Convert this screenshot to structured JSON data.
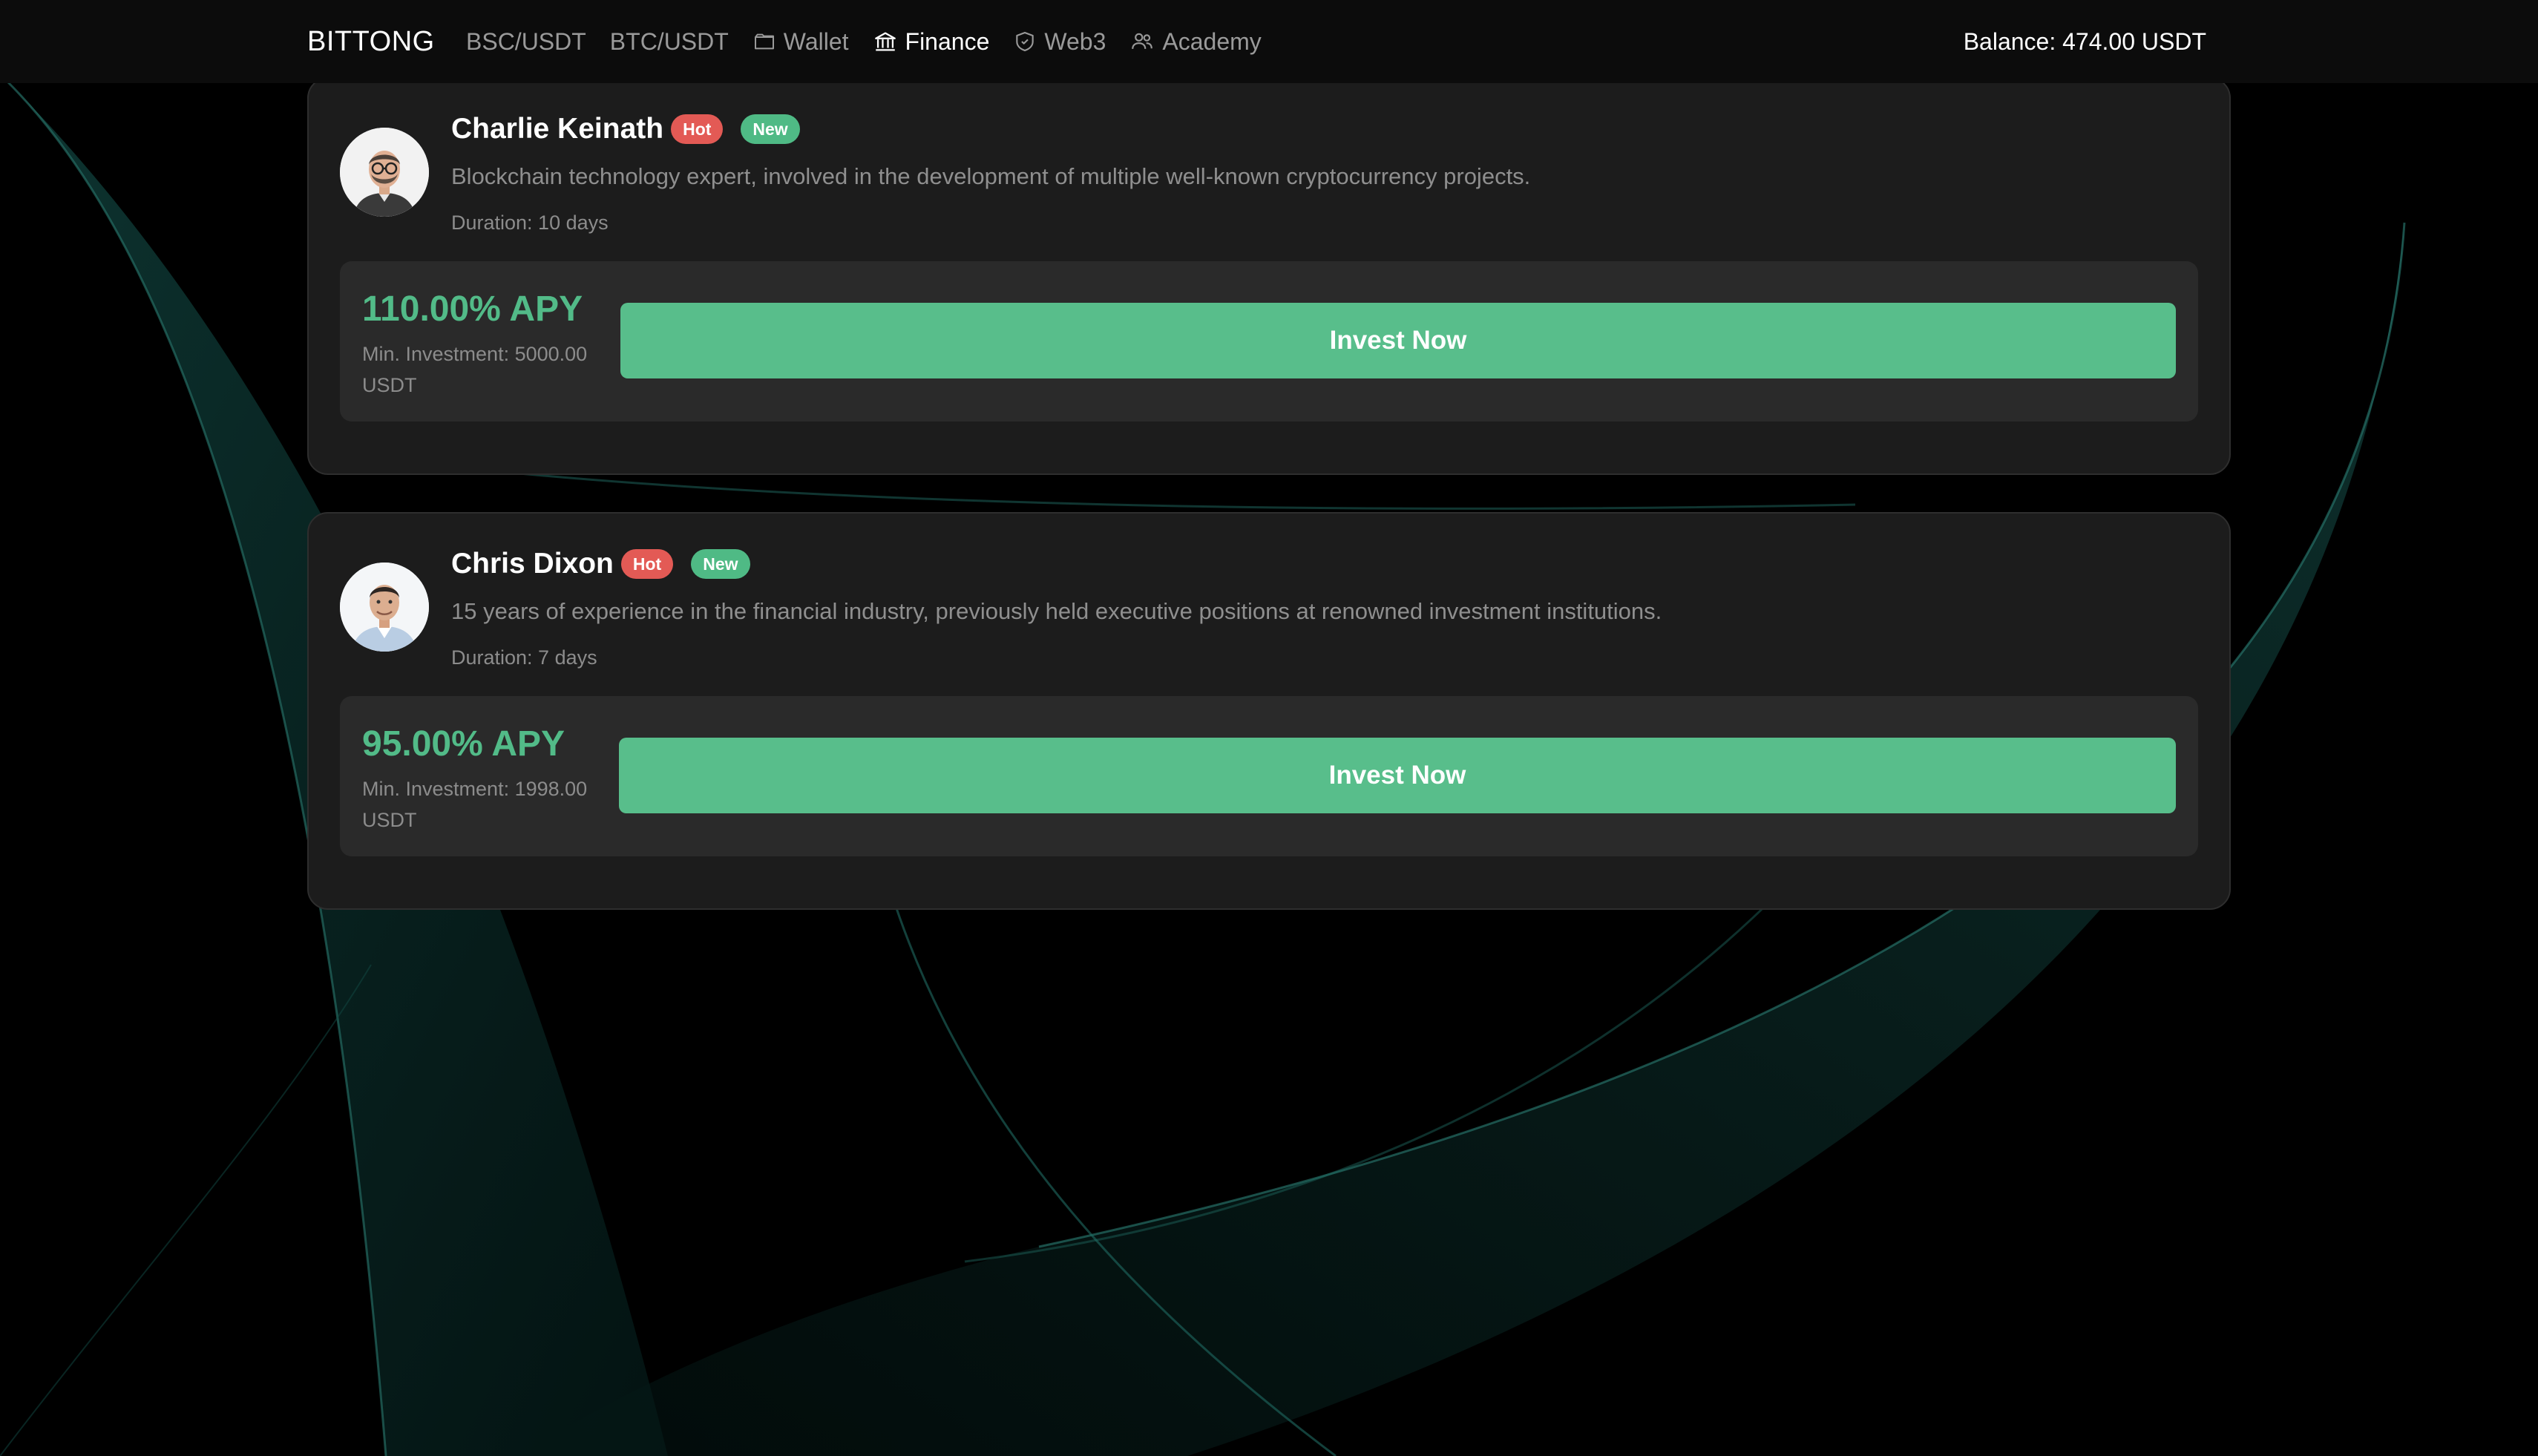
{
  "nav": {
    "brand": "BITTONG",
    "links": [
      {
        "label": "BSC/USDT",
        "icon": "",
        "active": false
      },
      {
        "label": "BTC/USDT",
        "icon": "",
        "active": false
      },
      {
        "label": "Wallet",
        "icon": "wallet-icon",
        "active": false
      },
      {
        "label": "Finance",
        "icon": "bank-icon",
        "active": true
      },
      {
        "label": "Web3",
        "icon": "shield-icon",
        "active": false
      },
      {
        "label": "Academy",
        "icon": "users-icon",
        "active": false
      }
    ],
    "balance": "Balance: 474.00 USDT"
  },
  "traders": [
    {
      "name": "Charlie Keinath",
      "hot_label": "Hot",
      "new_label": "New",
      "description": "Blockchain technology expert, involved in the development of multiple well-known cryptocurrency projects.",
      "duration": "Duration: 10 days",
      "apy": "110.00% APY",
      "min_investment": "Min. Investment: 5000.00 USDT",
      "button_label": "Invest Now"
    },
    {
      "name": "Chris Dixon",
      "hot_label": "Hot",
      "new_label": "New",
      "description": "15 years of experience in the financial industry, previously held executive positions at renowned investment institutions.",
      "duration": "Duration: 7 days",
      "apy": "95.00% APY",
      "min_investment": "Min. Investment: 1998.00 USDT",
      "button_label": "Invest Now"
    }
  ],
  "colors": {
    "background": "#000000",
    "navbar": "#0c0c0c",
    "card": "#1c1c1c",
    "panel": "#2a2a2a",
    "accent_green": "#58be8b",
    "apy_green": "#52bb88",
    "hot_red": "#e35a55",
    "muted_text": "#8f8f8f"
  }
}
